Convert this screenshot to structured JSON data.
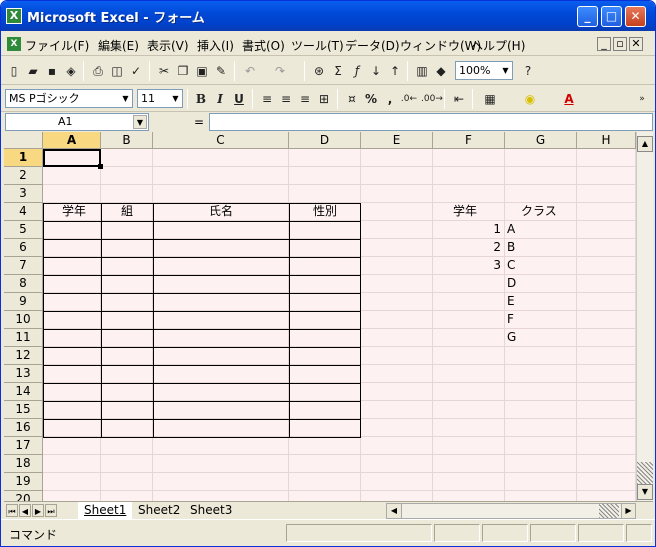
{
  "window": {
    "title": "Microsoft Excel - フォーム"
  },
  "menu": [
    "ファイル(F)",
    "編集(E)",
    "表示(V)",
    "挿入(I)",
    "書式(O)",
    "ツール(T)",
    "データ(D)",
    "ウィンドウ(W)",
    "ヘルプ(H)"
  ],
  "toolbar": {
    "zoom": "100%",
    "font_name": "MS Pゴシック",
    "font_size": "11"
  },
  "formula_bar": {
    "name_box": "A1",
    "equals": "=",
    "value": ""
  },
  "columns": [
    "A",
    "B",
    "C",
    "D",
    "E",
    "F",
    "G",
    "H"
  ],
  "rows": [
    "1",
    "2",
    "3",
    "4",
    "5",
    "6",
    "7",
    "8",
    "9",
    "10",
    "11",
    "12",
    "13",
    "14",
    "15",
    "16",
    "17",
    "18",
    "19",
    "20"
  ],
  "selected_cell": "A1",
  "table_headers": {
    "grade": "学年",
    "group": "組",
    "name": "氏名",
    "gender": "性別"
  },
  "lookup": {
    "grade_header": "学年",
    "class_header": "クラス",
    "grades": [
      "1",
      "2",
      "3"
    ],
    "classes": [
      "A",
      "B",
      "C",
      "D",
      "E",
      "F",
      "G"
    ]
  },
  "sheets": [
    "Sheet1",
    "Sheet2",
    "Sheet3"
  ],
  "active_sheet": "Sheet1",
  "status": "コマンド",
  "colors": {
    "title_bar": "#0049d8",
    "grid_bg": "#fdf1f1",
    "selected_header": "#f8d880"
  }
}
